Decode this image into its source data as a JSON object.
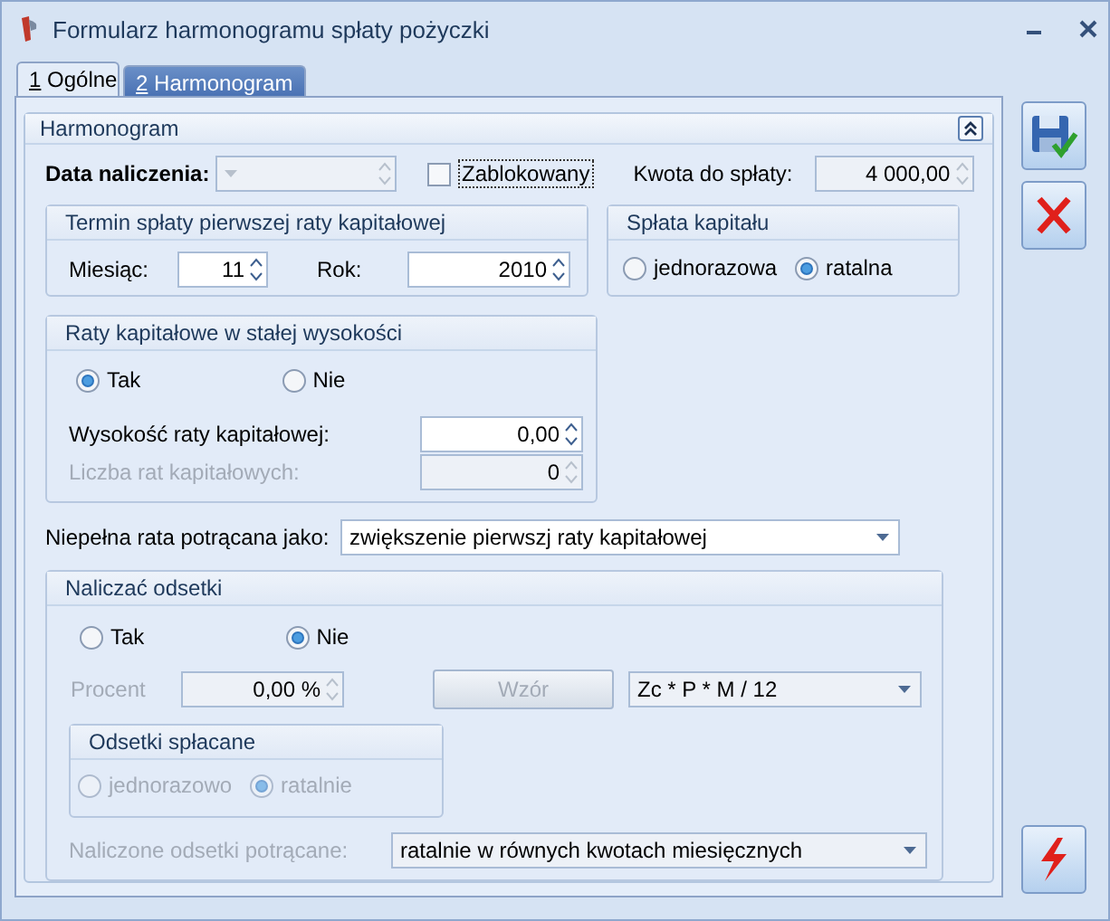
{
  "window": {
    "title": "Formularz harmonogramu spłaty pożyczki"
  },
  "tabs": [
    {
      "hotkey": "1",
      "label": "Ogólne",
      "selected": true
    },
    {
      "hotkey": "2",
      "label": "Harmonogram",
      "selected": false
    }
  ],
  "panel": {
    "title": "Harmonogram"
  },
  "data_naliczenia": {
    "label": "Data naliczenia:",
    "disabled": true
  },
  "zablokowany": {
    "label": "Zablokowany",
    "checked": false
  },
  "kwota": {
    "label": "Kwota do spłaty:",
    "value": "4 000,00"
  },
  "termin": {
    "title": "Termin spłaty pierwszej raty kapitałowej",
    "month_label": "Miesiąc:",
    "month": "11",
    "year_label": "Rok:",
    "year": "2010"
  },
  "splata_kapitalu": {
    "title": "Spłata kapitału",
    "options": [
      {
        "label": "jednorazowa",
        "selected": false
      },
      {
        "label": "ratalna",
        "selected": true
      }
    ]
  },
  "raty_stale": {
    "title": "Raty kapitałowe w stałej wysokości",
    "options": [
      {
        "label": "Tak",
        "selected": true
      },
      {
        "label": "Nie",
        "selected": false
      }
    ],
    "fields": [
      {
        "label": "Wysokość raty kapitałowej:",
        "value": "0,00",
        "disabled": false
      },
      {
        "label": "Liczba rat kapitałowych:",
        "value": "0",
        "disabled": true
      }
    ]
  },
  "niepelna": {
    "label": "Niepełna rata potrącana jako:",
    "value": "zwiększenie pierwszj raty kapitałowej"
  },
  "odsetki": {
    "title": "Naliczać odsetki",
    "options": [
      {
        "label": "Tak",
        "selected": false
      },
      {
        "label": "Nie",
        "selected": true
      }
    ],
    "procent": {
      "label": "Procent",
      "value": "0,00 %",
      "disabled": true
    },
    "wzor": {
      "label": "Wzór",
      "disabled": true
    },
    "formula": {
      "value": "Zc * P * M / 12",
      "disabled": true
    },
    "splacane": {
      "title": "Odsetki spłacane",
      "disabled": true,
      "options": [
        {
          "label": "jednorazowo",
          "selected": false
        },
        {
          "label": "ratalnie",
          "selected": true
        }
      ]
    },
    "potracane": {
      "label": "Naliczone odsetki potrącane:",
      "value": "ratalnie w równych kwotach miesięcznych",
      "disabled": true
    }
  }
}
